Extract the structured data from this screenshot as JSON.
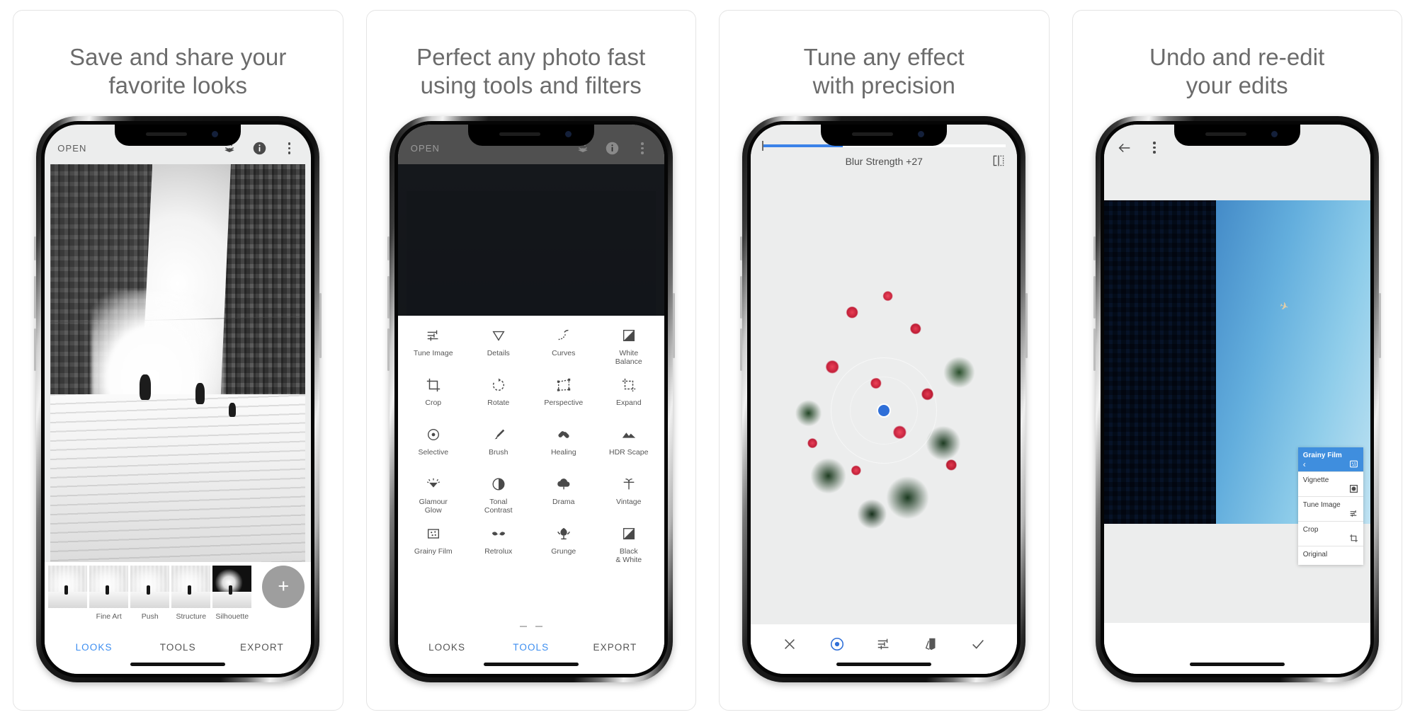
{
  "cards": [
    {
      "title": "Save and share your\nfavorite looks",
      "phone": {
        "appbar": {
          "open_label": "OPEN",
          "icons": [
            "layers-icon",
            "info-icon",
            "kebab-menu-icon"
          ]
        },
        "looks": [
          {
            "label": "Fine Art"
          },
          {
            "label": "Push"
          },
          {
            "label": "Structure"
          },
          {
            "label": "Silhouette"
          }
        ],
        "add_look_label": "+",
        "tabs": [
          {
            "label": "LOOKS",
            "active": true
          },
          {
            "label": "TOOLS",
            "active": false
          },
          {
            "label": "EXPORT",
            "active": false
          }
        ]
      }
    },
    {
      "title": "Perfect any photo fast\nusing tools and filters",
      "phone": {
        "appbar": {
          "open_label": "OPEN",
          "icons": [
            "layers-icon",
            "info-icon",
            "kebab-menu-icon"
          ]
        },
        "tools": [
          {
            "label": "Tune Image",
            "icon": "tune-image-icon"
          },
          {
            "label": "Details",
            "icon": "details-icon"
          },
          {
            "label": "Curves",
            "icon": "curves-icon"
          },
          {
            "label": "White\nBalance",
            "icon": "white-balance-icon"
          },
          {
            "label": "Crop",
            "icon": "crop-icon"
          },
          {
            "label": "Rotate",
            "icon": "rotate-icon"
          },
          {
            "label": "Perspective",
            "icon": "perspective-icon"
          },
          {
            "label": "Expand",
            "icon": "expand-icon"
          },
          {
            "label": "Selective",
            "icon": "selective-icon"
          },
          {
            "label": "Brush",
            "icon": "brush-icon"
          },
          {
            "label": "Healing",
            "icon": "healing-icon"
          },
          {
            "label": "HDR Scape",
            "icon": "hdr-scape-icon"
          },
          {
            "label": "Glamour\nGlow",
            "icon": "glamour-glow-icon"
          },
          {
            "label": "Tonal\nContrast",
            "icon": "tonal-contrast-icon"
          },
          {
            "label": "Drama",
            "icon": "drama-icon"
          },
          {
            "label": "Vintage",
            "icon": "vintage-icon"
          },
          {
            "label": "Grainy Film",
            "icon": "grainy-film-icon"
          },
          {
            "label": "Retrolux",
            "icon": "retrolux-icon"
          },
          {
            "label": "Grunge",
            "icon": "grunge-icon"
          },
          {
            "label": "Black\n& White",
            "icon": "black-and-white-icon"
          }
        ],
        "tabs": [
          {
            "label": "LOOKS",
            "active": false
          },
          {
            "label": "TOOLS",
            "active": true
          },
          {
            "label": "EXPORT",
            "active": false
          }
        ]
      }
    },
    {
      "title": "Tune any effect\nwith precision",
      "phone": {
        "adjustment_label": "Blur Strength +27",
        "slider_percent": 33,
        "compare_icon": "compare-icon",
        "bottom_icons": [
          {
            "name": "close-icon",
            "active": false
          },
          {
            "name": "selective-target-icon",
            "active": true
          },
          {
            "name": "adjust-sliders-icon",
            "active": false
          },
          {
            "name": "stack-compare-icon",
            "active": false
          },
          {
            "name": "confirm-check-icon",
            "active": false
          }
        ]
      }
    },
    {
      "title": "Undo and re-edit\nyour edits",
      "phone": {
        "appbar": {
          "back_icon": "back-arrow-icon",
          "menu_icon": "kebab-menu-icon"
        },
        "edit_stack": [
          {
            "label": "Grainy Film",
            "icon": "grainy-film-icon",
            "active": true
          },
          {
            "label": "Vignette",
            "icon": "vignette-icon",
            "active": false
          },
          {
            "label": "Tune Image",
            "icon": "tune-image-icon",
            "active": false
          },
          {
            "label": "Crop",
            "icon": "crop-icon",
            "active": false
          },
          {
            "label": "Original",
            "icon": "",
            "active": false
          }
        ]
      }
    }
  ],
  "colors": {
    "accent_blue": "#3d8ef0",
    "stack_blue": "#3f8ede",
    "text_gray": "#6b6b6b",
    "screen_bg": "#eceded"
  }
}
